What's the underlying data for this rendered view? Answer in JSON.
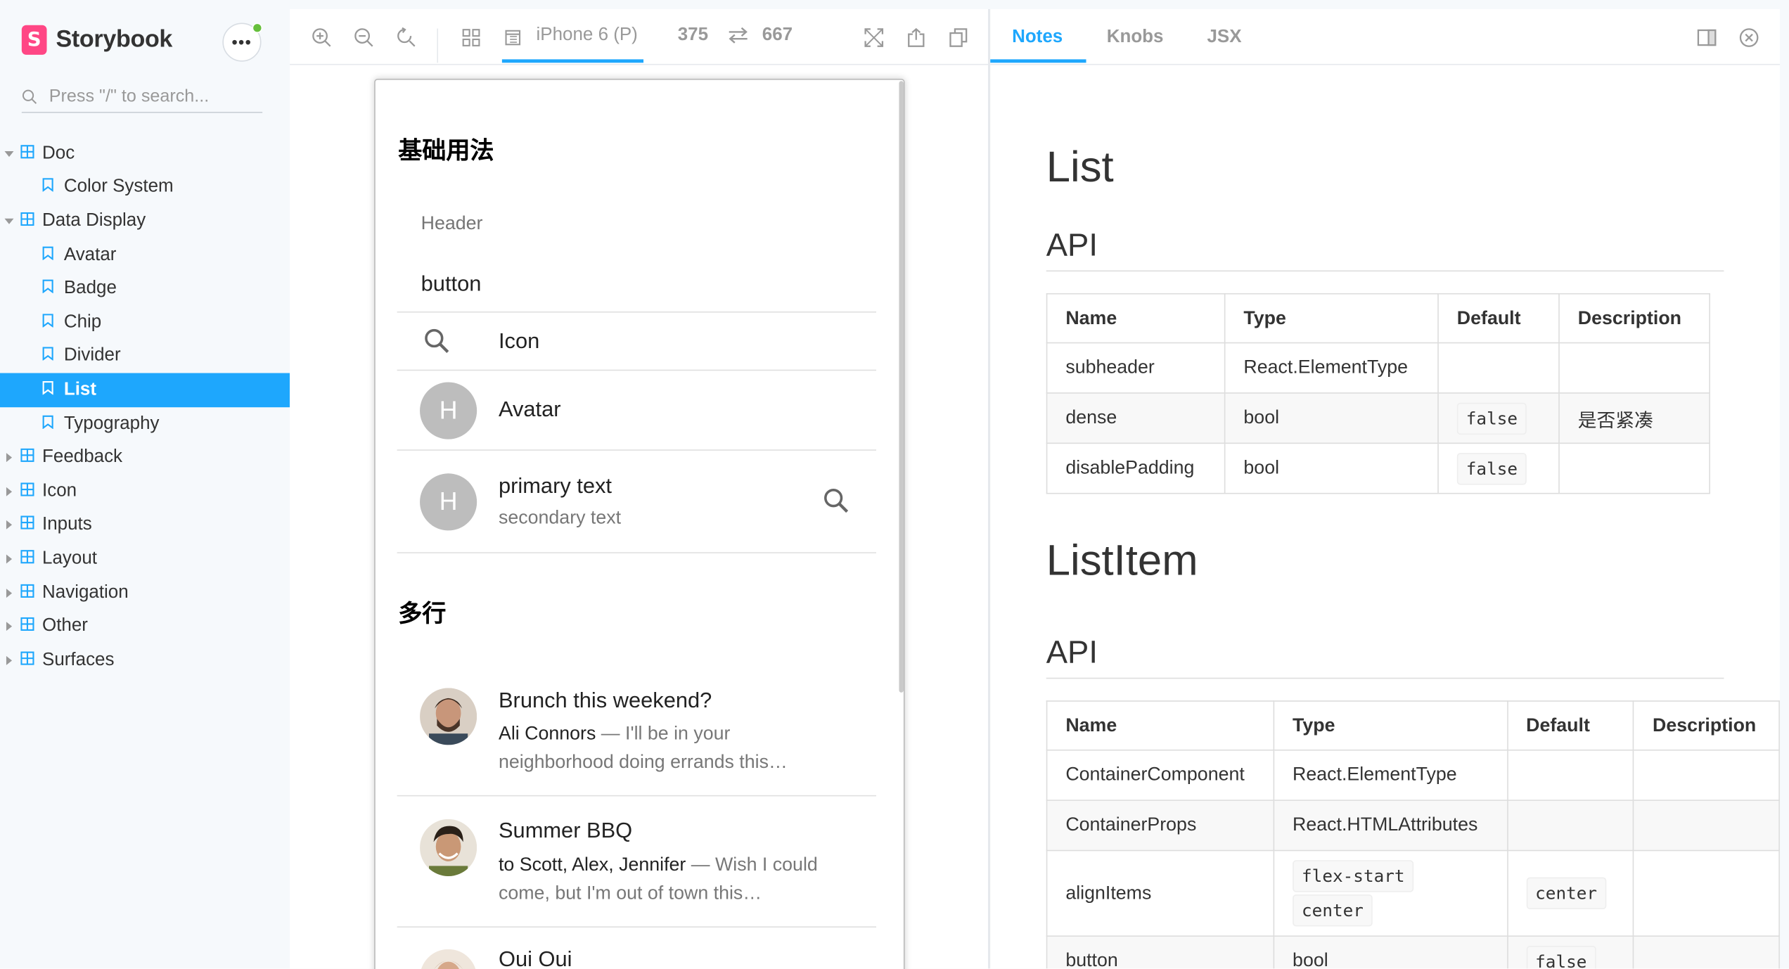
{
  "brand": {
    "name": "Storybook",
    "logo_letter": "S",
    "accent": "#ff4785"
  },
  "search": {
    "placeholder": "Press \"/\" to search..."
  },
  "sidebar": {
    "items": [
      {
        "label": "Doc",
        "type": "group",
        "expanded": true
      },
      {
        "label": "Color System",
        "type": "story"
      },
      {
        "label": "Data Display",
        "type": "group",
        "expanded": true
      },
      {
        "label": "Avatar",
        "type": "story"
      },
      {
        "label": "Badge",
        "type": "story"
      },
      {
        "label": "Chip",
        "type": "story"
      },
      {
        "label": "Divider",
        "type": "story"
      },
      {
        "label": "List",
        "type": "story",
        "active": true
      },
      {
        "label": "Typography",
        "type": "story"
      },
      {
        "label": "Feedback",
        "type": "group",
        "expanded": false
      },
      {
        "label": "Icon",
        "type": "group",
        "expanded": false
      },
      {
        "label": "Inputs",
        "type": "group",
        "expanded": false
      },
      {
        "label": "Layout",
        "type": "group",
        "expanded": false
      },
      {
        "label": "Navigation",
        "type": "group",
        "expanded": false
      },
      {
        "label": "Other",
        "type": "group",
        "expanded": false
      },
      {
        "label": "Surfaces",
        "type": "group",
        "expanded": false
      }
    ],
    "accent": "#1ea7fd"
  },
  "toolbar": {
    "icons": [
      "zoom-in-icon",
      "zoom-out-icon",
      "reset-zoom-icon",
      "grid-icon",
      "viewport-icon",
      "fullscreen-icon",
      "share-icon",
      "copy-icon"
    ],
    "device": "iPhone 6 (P)",
    "width": "375",
    "height": "667"
  },
  "preview": {
    "section1_title": "基础用法",
    "subheader": "Header",
    "button_item": "button",
    "icon_item": "Icon",
    "avatar_letter": "H",
    "avatar_item": "Avatar",
    "primary_text": "primary text",
    "secondary_text": "secondary text",
    "section2_title": "多行",
    "messages": [
      {
        "title": "Brunch this weekend?",
        "sender": "Ali Connors",
        "line1": " — I'll be in your",
        "line2": "neighborhood doing errands this…"
      },
      {
        "title": "Summer BBQ",
        "sender": "to Scott, Alex, Jennifer",
        "line1": " — Wish I could",
        "line2": "come, but I'm out of town this…"
      },
      {
        "title": "Oui Oui"
      }
    ]
  },
  "addons": {
    "tabs": [
      "Notes",
      "Knobs",
      "JSX"
    ],
    "active_tab": "Notes"
  },
  "notes": {
    "title1": "List",
    "api_heading": "API",
    "title2": "ListItem",
    "list_table": {
      "headers": [
        "Name",
        "Type",
        "Default",
        "Description"
      ],
      "rows": [
        {
          "name": "subheader",
          "type": "React.ElementType",
          "default": "",
          "description": ""
        },
        {
          "name": "dense",
          "type": "bool",
          "default": "false",
          "description": "是否紧凑"
        },
        {
          "name": "disablePadding",
          "type": "bool",
          "default": "false",
          "description": ""
        }
      ]
    },
    "listitem_table": {
      "headers": [
        "Name",
        "Type",
        "Default",
        "Description"
      ],
      "rows": [
        {
          "name": "ContainerComponent",
          "type": "React.ElementType",
          "default": "",
          "description": ""
        },
        {
          "name": "ContainerProps",
          "type": "React.HTMLAttributes",
          "default": "",
          "description": ""
        },
        {
          "name": "alignItems",
          "type": [
            "flex-start",
            "center"
          ],
          "default": "center",
          "description": ""
        },
        {
          "name": "button",
          "type": "bool",
          "default": "false",
          "description": ""
        }
      ]
    }
  }
}
